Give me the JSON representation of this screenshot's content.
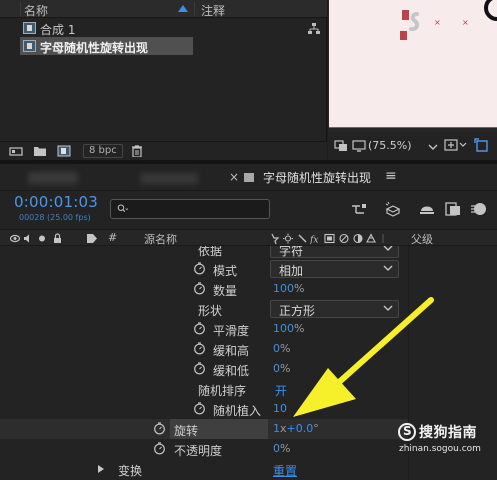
{
  "project": {
    "col_name": "名称",
    "col_note": "注释",
    "items": [
      {
        "label": "合成 1",
        "selected": false
      },
      {
        "label": "字母随机性旋转出现",
        "selected": true
      }
    ],
    "bpc_label": "8 bpc"
  },
  "viewer": {
    "zoom": "(75.5%)"
  },
  "timeline": {
    "tab_close": "×",
    "tab_title": "字母随机性旋转出现",
    "tab_menu": "≡",
    "timecode": "0:00:01:03",
    "fps_info": "00028 (25.00 fps)",
    "search_placeholder": "",
    "columns": {
      "hash": "#",
      "source_name": "源名称",
      "parent": "父级"
    },
    "rows": [
      {
        "name": "依据",
        "value": "字符",
        "kind": "dropdown",
        "stopwatch": false
      },
      {
        "name": "模式",
        "value": "相加",
        "kind": "dropdown",
        "stopwatch": true
      },
      {
        "name": "数量",
        "value": "100",
        "unit": "%",
        "kind": "value",
        "stopwatch": true
      },
      {
        "name": "形状",
        "value": "正方形",
        "kind": "dropdown",
        "stopwatch": false
      },
      {
        "name": "平滑度",
        "value": "100",
        "unit": "%",
        "kind": "value",
        "stopwatch": true
      },
      {
        "name": "缓和高",
        "value": "0",
        "unit": "%",
        "kind": "value",
        "stopwatch": true
      },
      {
        "name": "缓和低",
        "value": "0",
        "unit": "%",
        "kind": "value",
        "stopwatch": true
      },
      {
        "name": "随机排序",
        "value": "开",
        "kind": "value",
        "stopwatch": false
      },
      {
        "name": "随机植入",
        "value": "10",
        "kind": "value",
        "stopwatch": true
      },
      {
        "name": "旋转",
        "value": "1",
        "unit_mid": "x",
        "value2": "+0.0",
        "unit": "°",
        "kind": "value",
        "stopwatch": true
      },
      {
        "name": "不透明度",
        "value": "0",
        "unit": "%",
        "kind": "value",
        "stopwatch": true
      },
      {
        "name": "变换",
        "value": "重置",
        "kind": "link",
        "stopwatch": false
      }
    ]
  },
  "watermark": {
    "brand": "搜狗指南",
    "url": "zhinan.sogou.com"
  },
  "colors": {
    "accent_blue": "#3d8ee8",
    "annotation_arrow": "#f5f02a",
    "panel_bg": "#232323"
  }
}
